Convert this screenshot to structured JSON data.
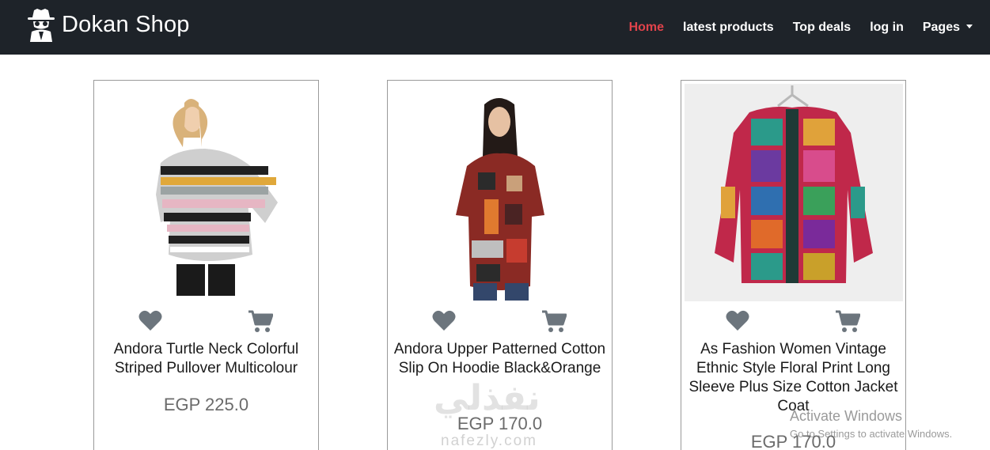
{
  "header": {
    "brand": "Dokan Shop",
    "brand_icon": "spy-icon",
    "nav": {
      "home": "Home",
      "latest": "latest products",
      "deals": "Top deals",
      "login": "log in",
      "pages": "Pages"
    },
    "colors": {
      "background": "#1e2329",
      "active": "#e0434b"
    }
  },
  "products": [
    {
      "title": "Andora Turtle Neck Colorful Striped Pullover Multicolour",
      "price": "EGP 225.0",
      "icons": [
        "heart-icon",
        "cart-icon"
      ]
    },
    {
      "title": "Andora Upper Patterned Cotton Slip On Hoodie Black&Orange",
      "price": "EGP 170.0",
      "icons": [
        "heart-icon",
        "cart-icon"
      ]
    },
    {
      "title": "As Fashion Women Vintage Ethnic Style Floral Print Long Sleeve Plus Size Cotton Jacket Coat",
      "price": "EGP 170.0",
      "icons": [
        "heart-icon",
        "cart-icon"
      ]
    }
  ],
  "watermark": {
    "logo": "نفذلي",
    "site": "nafezly.com"
  },
  "os_notice": {
    "title": "Activate Windows",
    "subtitle": "Go to Settings to activate Windows."
  }
}
